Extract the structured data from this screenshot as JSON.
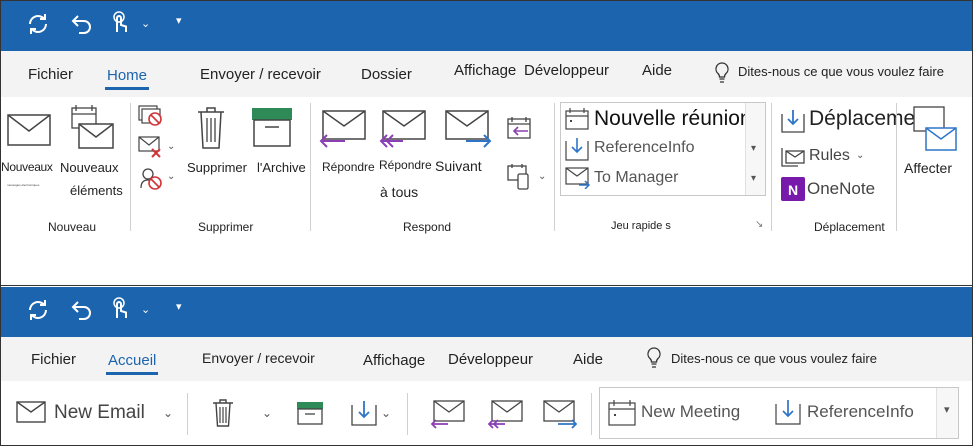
{
  "top": {
    "qat": {
      "icons": [
        "sync-icon",
        "undo-icon",
        "touch-mode-icon",
        "chevron-down-icon",
        "customize-qat-icon"
      ]
    },
    "tabs": [
      "Fichier",
      "Home",
      "Envoyer / recevoir",
      "Dossier",
      "Affichage",
      "Développeur",
      "Aide"
    ],
    "tell_me": "Dites-nous ce que vous voulez faire",
    "tell_me_icon": "lightbulb-icon",
    "groups": {
      "nouveau": {
        "label": "Nouveau",
        "new_email": "Nouveaux",
        "new_email_sub": "messages électroniques",
        "new_items_1": "Nouveaux",
        "new_items_2": "éléments"
      },
      "supprimer": {
        "label": "Supprimer",
        "delete": "Supprimer",
        "archive": "l'Archive"
      },
      "respond": {
        "label": "Respond",
        "reply": "Répondre",
        "reply_all_1": "Répondre",
        "reply_all_2": "à tous",
        "forward": "Suivant"
      },
      "quick_steps": {
        "label": "Jeu rapide s",
        "items": [
          "Nouvelle réunion",
          "ReferenceInfo",
          "To Manager"
        ]
      },
      "move": {
        "label": "Déplacement",
        "move": "Déplacement",
        "rules": "Rules",
        "onenote": "OneNote"
      },
      "tags": {
        "assign": "Affecter"
      }
    }
  },
  "bottom": {
    "tabs": [
      "Fichier",
      "Accueil",
      "Envoyer / recevoir",
      "Affichage",
      "Développeur",
      "Aide"
    ],
    "tell_me": "Dites-nous ce que vous voulez faire",
    "new_email": "New Email",
    "gallery": [
      "New Meeting",
      "ReferenceInfo"
    ]
  },
  "colors": {
    "brand_blue": "#1c64ae",
    "accent_blue": "#2e75c8",
    "reply_purple": "#8a3fb5",
    "delete_red": "#d13438",
    "archive_green": "#2e8b57",
    "onenote_purple": "#7719aa"
  }
}
